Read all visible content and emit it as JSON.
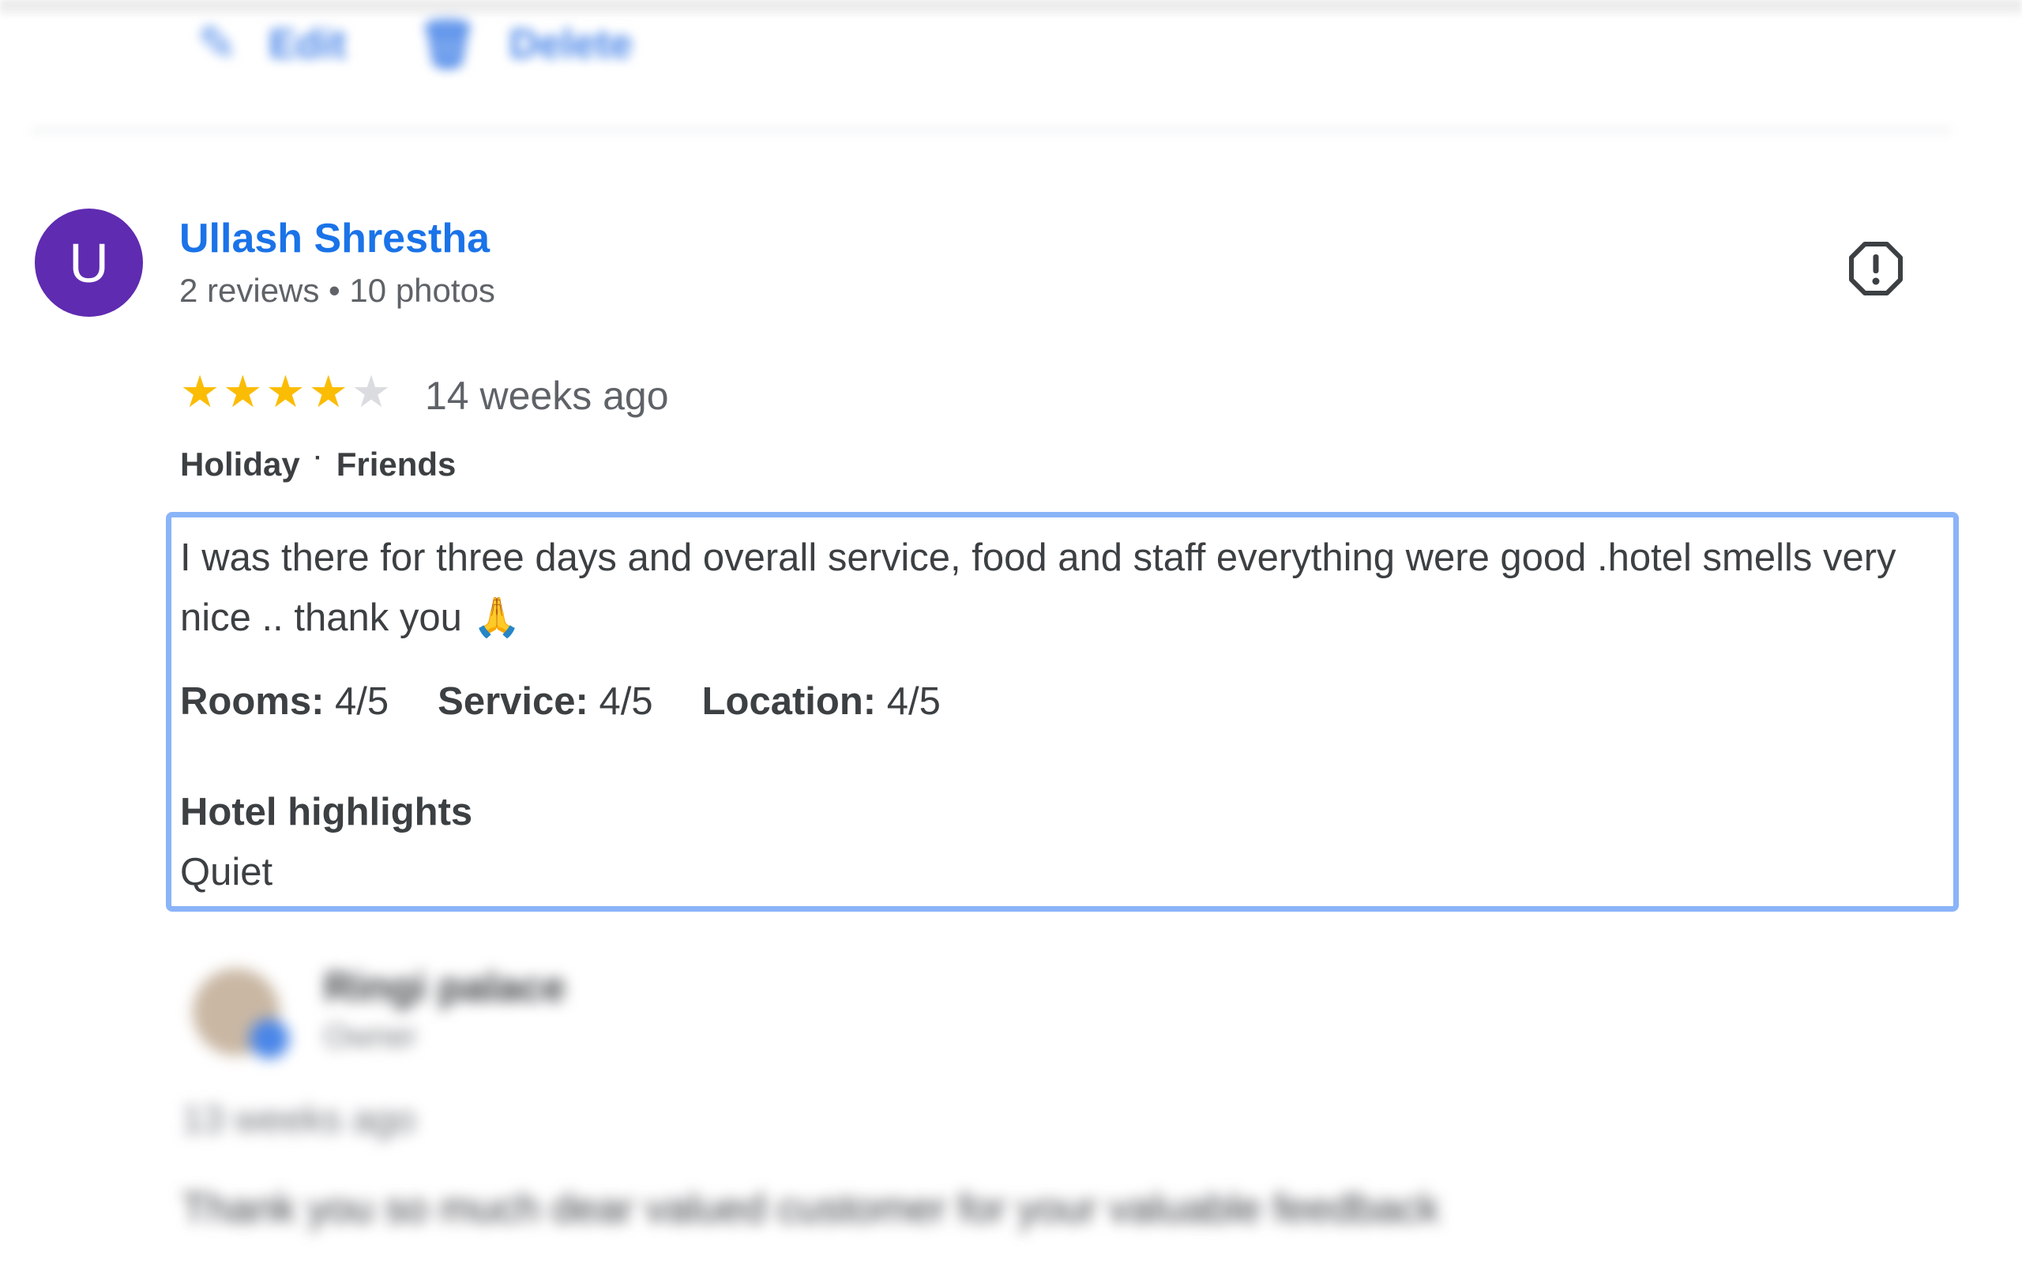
{
  "top_actions": {
    "edit_label": "Edit",
    "delete_label": "Delete"
  },
  "reviewer": {
    "avatar_letter": "U",
    "avatar_color": "#5f2bb1",
    "name": "Ullash Shrestha",
    "meta": "2 reviews • 10 photos"
  },
  "review": {
    "rating": 4,
    "rating_max": 5,
    "stars": [
      "★",
      "★",
      "★",
      "★",
      "★"
    ],
    "time_ago": "14 weeks ago",
    "trip_type": "Holiday",
    "tag_separator": "·",
    "travel_group": "Friends",
    "text": "I was there for three days and overall service, food and staff everything were good .hotel smells very nice .. thank you 🙏",
    "sub_ratings": [
      {
        "label": "Rooms:",
        "value": "4/5"
      },
      {
        "label": "Service:",
        "value": "4/5"
      },
      {
        "label": "Location:",
        "value": "4/5"
      }
    ],
    "highlights_title": "Hotel highlights",
    "highlights_value": "Quiet"
  },
  "owner_response": {
    "name": "Ringi palace",
    "role": "Owner",
    "time_ago": "13 weeks ago",
    "text": "Thank you so much dear valued customer for your valuable feedback"
  },
  "colors": {
    "link_blue": "#1a73e8",
    "star_gold": "#fbbc04",
    "highlight_border": "#8ab4f8"
  },
  "icons": {
    "report": "report-flag-icon",
    "edit": "pencil-icon",
    "delete": "trash-icon"
  }
}
